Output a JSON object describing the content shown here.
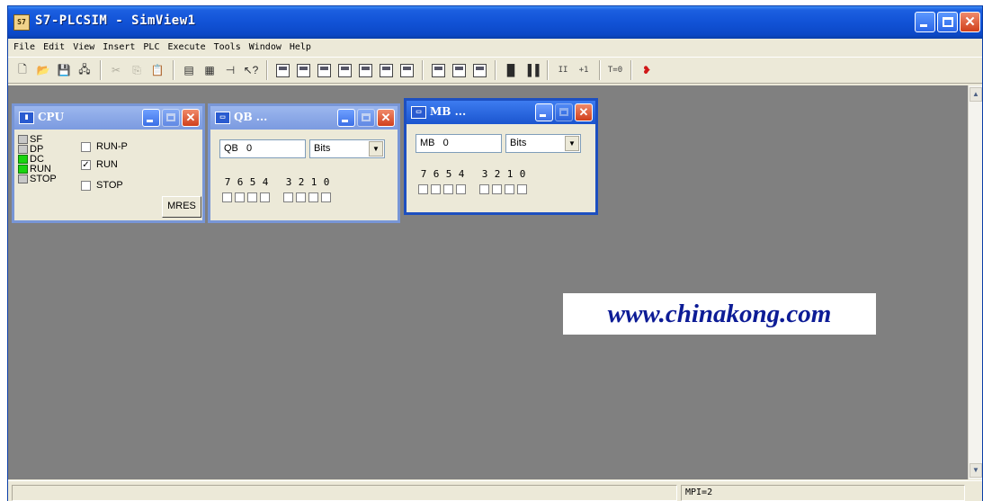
{
  "window": {
    "title": "S7-PLCSIM - SimView1",
    "icon": "app-icon"
  },
  "menu": [
    {
      "label": "File",
      "accel": "F"
    },
    {
      "label": "Edit",
      "accel": "E"
    },
    {
      "label": "View",
      "accel": "V"
    },
    {
      "label": "Insert",
      "accel": "I"
    },
    {
      "label": "PLC",
      "accel": "P"
    },
    {
      "label": "Execute",
      "accel": "x"
    },
    {
      "label": "Tools",
      "accel": "T"
    },
    {
      "label": "Window",
      "accel": "W"
    },
    {
      "label": "Help",
      "accel": "H"
    }
  ],
  "toolbar": {
    "run_step_label": "+1",
    "timer_reset_label": "T=0"
  },
  "cpu_window": {
    "title": "CPU",
    "leds": [
      {
        "label": "SF",
        "on": false
      },
      {
        "label": "DP",
        "on": false
      },
      {
        "label": "DC",
        "on": true
      },
      {
        "label": "RUN",
        "on": true
      },
      {
        "label": "STOP",
        "on": false
      }
    ],
    "modes": [
      {
        "label": "RUN-P",
        "checked": false
      },
      {
        "label": "RUN",
        "checked": true
      },
      {
        "label": "STOP",
        "checked": false
      }
    ],
    "mres_label": "MRES"
  },
  "qb_window": {
    "title": "QB ...",
    "address": "QB   0",
    "format": "Bits",
    "bit_labels_high": [
      "7",
      "6",
      "5",
      "4"
    ],
    "bit_labels_low": [
      "3",
      "2",
      "1",
      "0"
    ]
  },
  "mb_window": {
    "title": "MB ...",
    "address": "MB   0",
    "format": "Bits",
    "bit_labels_high": [
      "7",
      "6",
      "5",
      "4"
    ],
    "bit_labels_low": [
      "3",
      "2",
      "1",
      "0"
    ]
  },
  "watermark": "www.chinakong.com",
  "status": {
    "mpi": "MPI=2"
  }
}
